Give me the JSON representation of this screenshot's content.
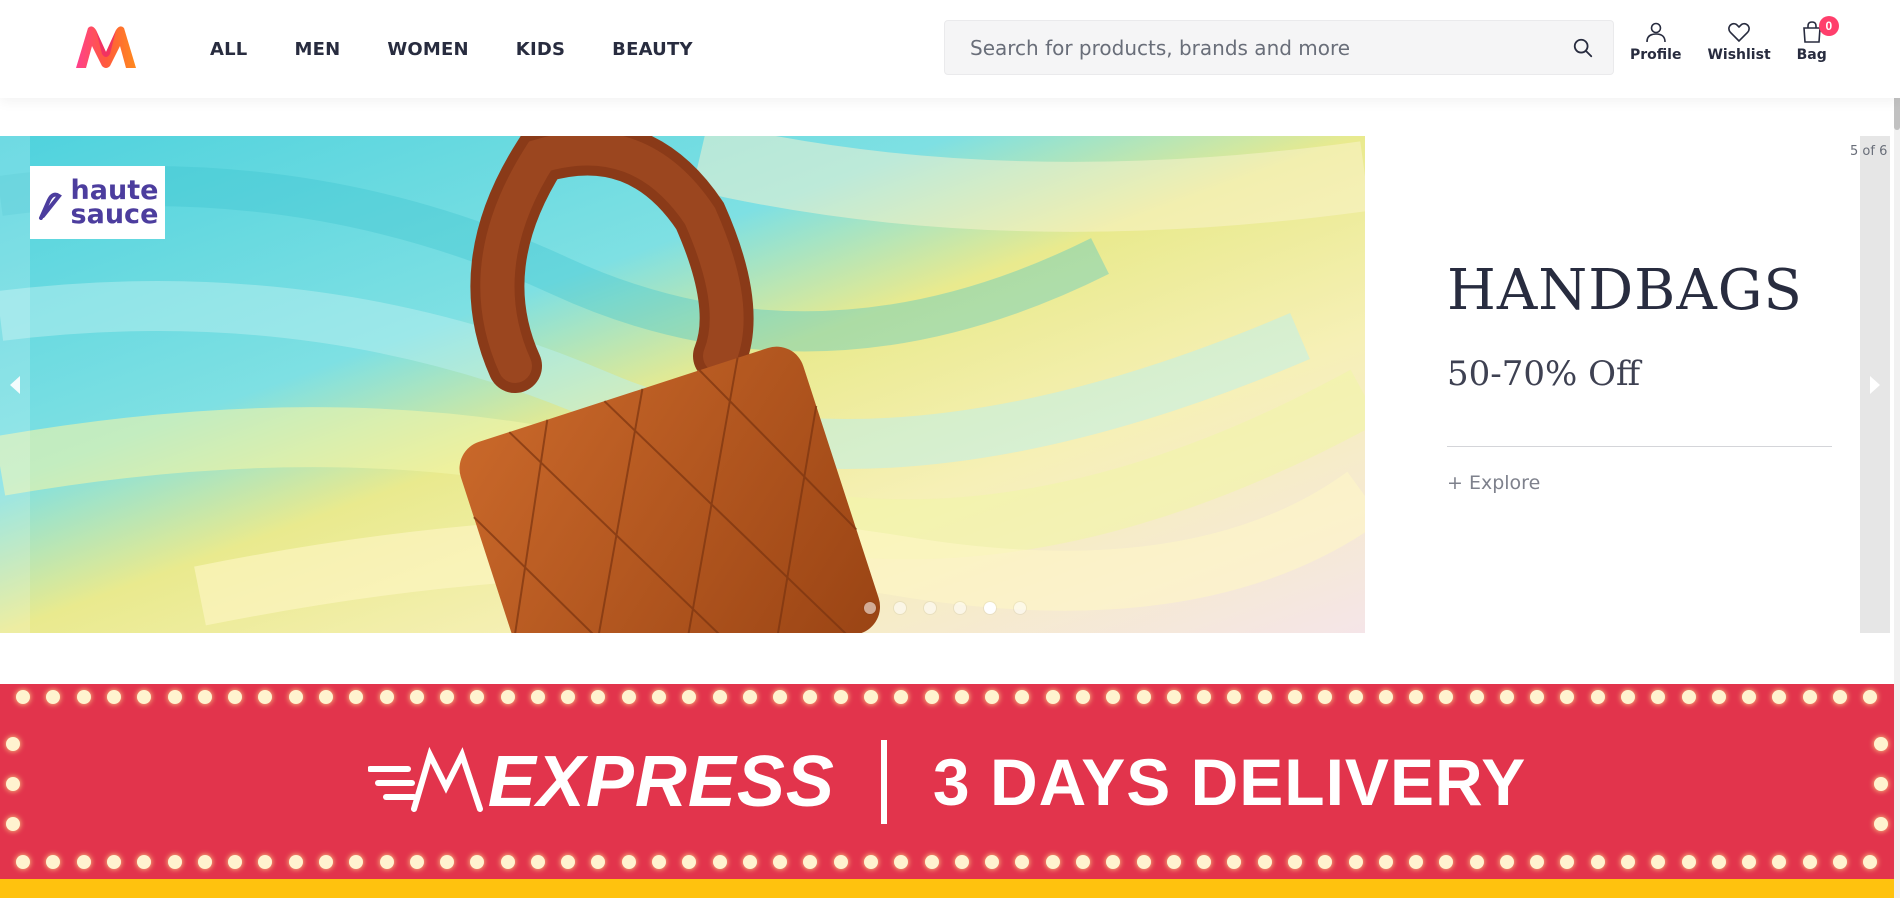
{
  "header": {
    "nav": [
      "ALL",
      "MEN",
      "WOMEN",
      "KIDS",
      "BEAUTY"
    ],
    "search_placeholder": "Search for products, brands and more",
    "actions": {
      "profile": "Profile",
      "wishlist": "Wishlist",
      "bag": "Bag",
      "bag_count": "0"
    }
  },
  "carousel": {
    "brand_line1": "haute",
    "brand_line2": "sauce",
    "counter": "5 of 6",
    "title": "HANDBAGS",
    "offer": "50-70% Off",
    "explore": "+ Explore",
    "total_slides": 6,
    "active_slide": 5
  },
  "express_banner": {
    "logo_text": "EXPRESS",
    "delivery_text": "3 DAYS DELIVERY"
  },
  "colors": {
    "brand_accent": "#ff3f6c",
    "banner_red": "#e2344c",
    "banner_yellow": "#ffc20e",
    "bag_brown": "#b8571f"
  },
  "icons": [
    "myntra-logo",
    "search-icon",
    "profile-icon",
    "wishlist-icon",
    "bag-icon",
    "brand-logo-icon",
    "chevron-left-icon",
    "chevron-right-icon",
    "express-logo-icon"
  ]
}
